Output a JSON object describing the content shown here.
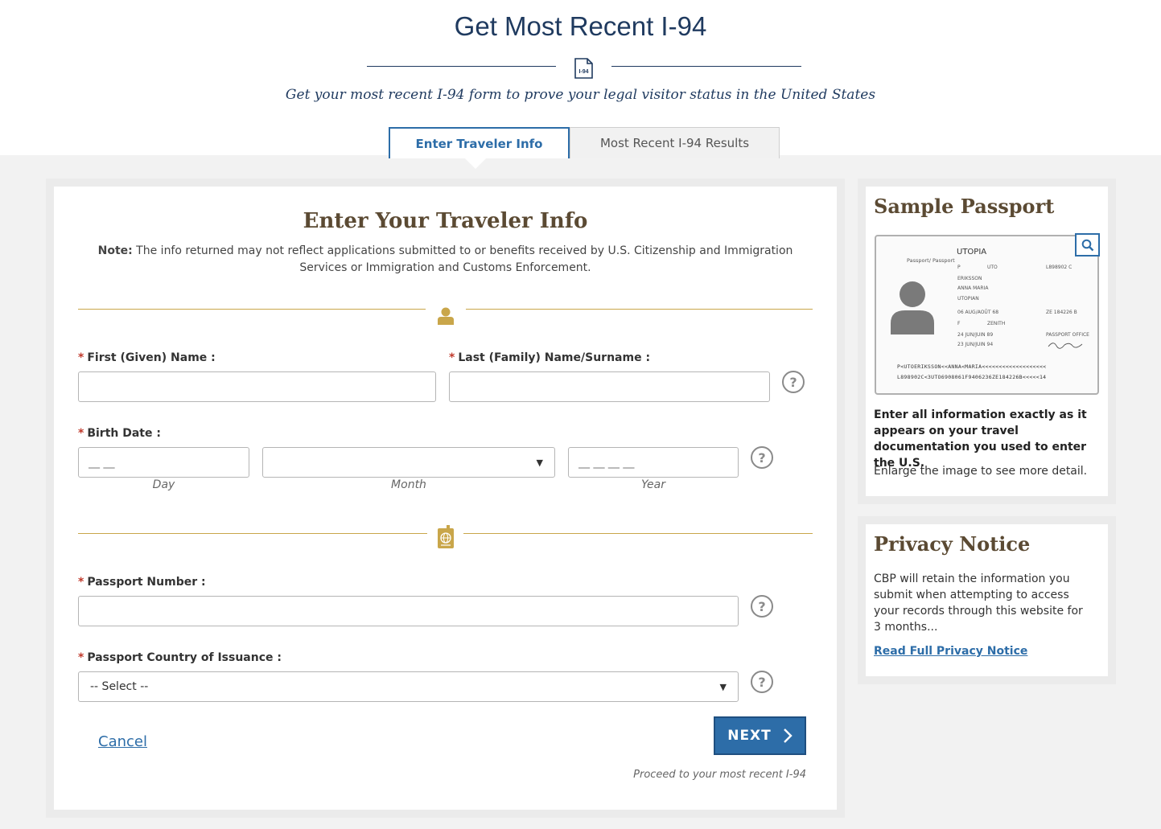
{
  "header": {
    "title": "Get Most Recent I-94",
    "icon_text": "I-94",
    "subtitle": "Get your most recent I-94 form to prove your legal visitor status in the United States"
  },
  "tabs": [
    {
      "label": "Enter Traveler Info",
      "active": true
    },
    {
      "label": "Most Recent I-94 Results",
      "active": false
    }
  ],
  "form": {
    "title": "Enter Your Traveler Info",
    "note_label": "Note:",
    "note_text": " The info returned may not reflect applications submitted to or benefits received by U.S. Citizenship and Immigration Services or Immigration and Customs Enforcement.",
    "required_mark": "*",
    "first_name_label": "First (Given) Name :",
    "last_name_label": "Last (Family) Name/Surname :",
    "birth_date_label": "Birth Date :",
    "day_placeholder": "__ __",
    "year_placeholder": "__ __ __ __",
    "day_hint": "Day",
    "month_hint": "Month",
    "year_hint": "Year",
    "month_value": "",
    "passport_number_label": "Passport Number :",
    "country_label": "Passport Country of Issuance :",
    "country_value": "-- Select --",
    "help_symbol": "?",
    "cancel_label": "Cancel",
    "next_label": "NEXT",
    "proceed_text": "Proceed to your most recent I-94"
  },
  "sample_passport": {
    "title": "Sample Passport",
    "strong_text": "Enter all information exactly as it appears on your travel documentation you used to enter the U.S.",
    "hint_text": "Enlarge the image to see more detail.",
    "image": {
      "country": "UTOPIA",
      "passport_word": "Passport/ Passport",
      "type": "P",
      "code": "UTO",
      "number": "L898902 C",
      "surname": "ERIKSSON",
      "given_names": "ANNA MARIA",
      "nationality": "UTOPIAN",
      "dob": "06 AUG/AOÛT 68",
      "personal_no": "ZE 184226 B",
      "sex": "F",
      "place_of_birth": "ZENITH",
      "issue_date": "24 JUN/JUIN 89",
      "authority": "PASSPORT OFFICE",
      "expiry_date": "23 JUN/JUIN 94",
      "mrz1": "P<UTOERIKSSON<<ANNA<MARIA<<<<<<<<<<<<<<<<<<<",
      "mrz2": "L898902C<3UTO6908061F9406236ZE184226B<<<<<14"
    }
  },
  "privacy": {
    "title": "Privacy Notice",
    "text": "CBP will retain the information you submit when attempting to access your records through this website for 3 months...",
    "link": "Read Full Privacy Notice"
  },
  "colors": {
    "navy": "#1f3a5f",
    "accent_blue": "#2d6da8",
    "gold": "#c9a64a",
    "brown_heading": "#5b4a33",
    "required_red": "#c0392b"
  }
}
